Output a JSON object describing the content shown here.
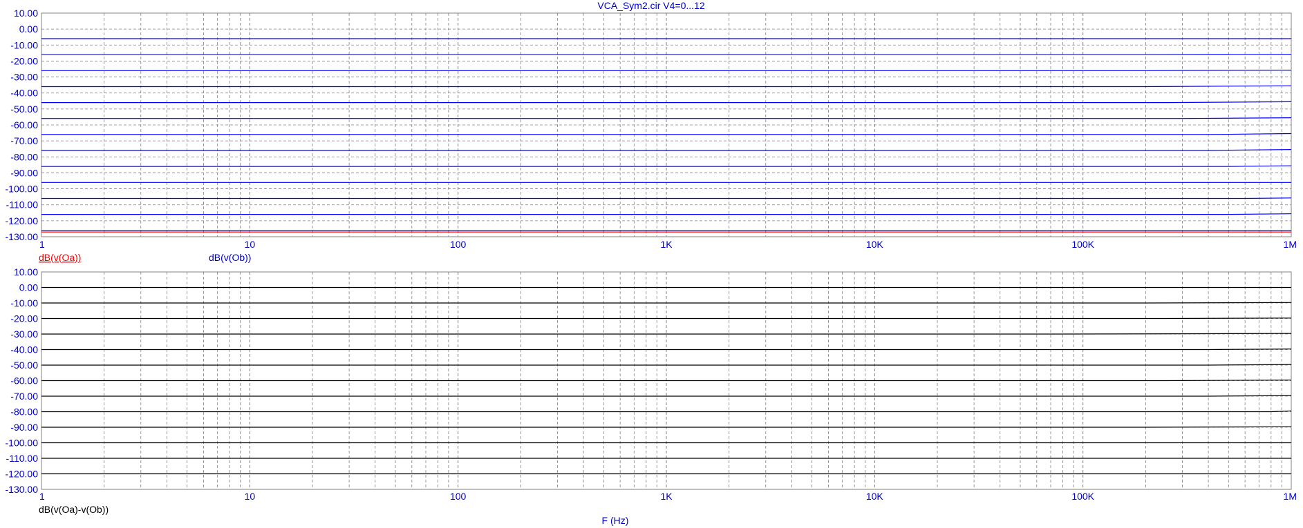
{
  "title": "VCA_Sym2.cir V4=0...12",
  "xlabel": "F (Hz)",
  "colors": {
    "axis_text": "#0000cc",
    "trace_oa": "#ff0000",
    "trace_ob": "#0000ff",
    "trace_diff": "#000000",
    "grid": "#808080"
  },
  "chart_data": [
    {
      "type": "line",
      "x_scale": "log",
      "xlim": [
        1,
        1000000
      ],
      "ylim": [
        -130,
        10
      ],
      "x_ticks": [
        {
          "value": 1,
          "label": "1"
        },
        {
          "value": 10,
          "label": "10"
        },
        {
          "value": 100,
          "label": "100"
        },
        {
          "value": 1000,
          "label": "1K"
        },
        {
          "value": 10000,
          "label": "10K"
        },
        {
          "value": 100000,
          "label": "100K"
        },
        {
          "value": 1000000,
          "label": "1M"
        }
      ],
      "y_ticks": [
        {
          "value": 10,
          "label": "10.00"
        },
        {
          "value": 0,
          "label": "0.00"
        },
        {
          "value": -10,
          "label": "-10.00"
        },
        {
          "value": -20,
          "label": "-20.00"
        },
        {
          "value": -30,
          "label": "-30.00"
        },
        {
          "value": -40,
          "label": "-40.00"
        },
        {
          "value": -50,
          "label": "-50.00"
        },
        {
          "value": -60,
          "label": "-60.00"
        },
        {
          "value": -70,
          "label": "-70.00"
        },
        {
          "value": -80,
          "label": "-80.00"
        },
        {
          "value": -90,
          "label": "-90.00"
        },
        {
          "value": -100,
          "label": "-100.00"
        },
        {
          "value": -110,
          "label": "-110.00"
        },
        {
          "value": -120,
          "label": "-120.00"
        },
        {
          "value": -130,
          "label": "-130.00"
        }
      ],
      "grid": true,
      "legend": [
        {
          "label": "dB(v(Oa))",
          "color": "#ff0000",
          "underline": true
        },
        {
          "label": "dB(v(Ob))",
          "color": "#0000cc",
          "underline": false
        }
      ],
      "series": [
        {
          "color": "#0000ff",
          "x": [
            1,
            1000000
          ],
          "y": [
            -6,
            -6
          ]
        },
        {
          "color": "#0000ff",
          "x": [
            1,
            200000,
            1000000
          ],
          "y": [
            -16,
            -16,
            -15.8
          ]
        },
        {
          "color": "#0000ff",
          "x": [
            1,
            200000,
            1000000
          ],
          "y": [
            -26,
            -26,
            -25.7
          ]
        },
        {
          "color": "#0000ff",
          "x": [
            1,
            200000,
            1000000
          ],
          "y": [
            -36,
            -36,
            -35.5
          ]
        },
        {
          "color": "#0000ff",
          "x": [
            1,
            250000,
            1000000
          ],
          "y": [
            -46,
            -46,
            -45.5
          ]
        },
        {
          "color": "#0000ff",
          "x": [
            1,
            300000,
            1000000
          ],
          "y": [
            -56,
            -56,
            -55.5
          ]
        },
        {
          "color": "#0000ff",
          "x": [
            1,
            400000,
            1000000
          ],
          "y": [
            -66,
            -66,
            -65.4
          ]
        },
        {
          "color": "#0000ff",
          "x": [
            1,
            400000,
            1000000
          ],
          "y": [
            -76,
            -76,
            -75.4
          ]
        },
        {
          "color": "#0000ff",
          "x": [
            1,
            500000,
            1000000
          ],
          "y": [
            -86,
            -86,
            -85.6
          ]
        },
        {
          "color": "#0000ff",
          "x": [
            1,
            1000000
          ],
          "y": [
            -96,
            -96
          ]
        },
        {
          "color": "#0000ff",
          "x": [
            1,
            600000,
            1000000
          ],
          "y": [
            -106,
            -106,
            -105.7
          ]
        },
        {
          "color": "#0000ff",
          "x": [
            1,
            500000,
            1000000
          ],
          "y": [
            -116,
            -116,
            -115.6
          ]
        },
        {
          "color": "#0000ff",
          "x": [
            1,
            1000000
          ],
          "y": [
            -126,
            -126
          ]
        },
        {
          "color": "#ff0000",
          "x": [
            1,
            1000000
          ],
          "y": [
            -127,
            -127
          ]
        }
      ]
    },
    {
      "type": "line",
      "x_scale": "log",
      "xlim": [
        1,
        1000000
      ],
      "ylim": [
        -130,
        10
      ],
      "x_ticks": [
        {
          "value": 1,
          "label": "1"
        },
        {
          "value": 10,
          "label": "10"
        },
        {
          "value": 100,
          "label": "100"
        },
        {
          "value": 1000,
          "label": "1K"
        },
        {
          "value": 10000,
          "label": "10K"
        },
        {
          "value": 100000,
          "label": "100K"
        },
        {
          "value": 1000000,
          "label": "1M"
        }
      ],
      "y_ticks": [
        {
          "value": 10,
          "label": "10.00"
        },
        {
          "value": 0,
          "label": "0.00"
        },
        {
          "value": -10,
          "label": "-10.00"
        },
        {
          "value": -20,
          "label": "-20.00"
        },
        {
          "value": -30,
          "label": "-30.00"
        },
        {
          "value": -40,
          "label": "-40.00"
        },
        {
          "value": -50,
          "label": "-50.00"
        },
        {
          "value": -60,
          "label": "-60.00"
        },
        {
          "value": -70,
          "label": "-70.00"
        },
        {
          "value": -80,
          "label": "-80.00"
        },
        {
          "value": -90,
          "label": "-90.00"
        },
        {
          "value": -100,
          "label": "-100.00"
        },
        {
          "value": -110,
          "label": "-110.00"
        },
        {
          "value": -120,
          "label": "-120.00"
        },
        {
          "value": -130,
          "label": "-130.00"
        }
      ],
      "grid": true,
      "legend": [
        {
          "label": "dB(v(Oa)-v(Ob))",
          "color": "#000000",
          "underline": false
        }
      ],
      "series": [
        {
          "color": "#000000",
          "x": [
            1,
            1000000
          ],
          "y": [
            0,
            0
          ]
        },
        {
          "color": "#000000",
          "x": [
            1,
            200000,
            1000000
          ],
          "y": [
            -10,
            -10,
            -9.7
          ]
        },
        {
          "color": "#000000",
          "x": [
            1,
            250000,
            1000000
          ],
          "y": [
            -20,
            -20,
            -19.7
          ]
        },
        {
          "color": "#000000",
          "x": [
            1,
            80000,
            400000,
            1000000
          ],
          "y": [
            -30,
            -30,
            -29.8,
            -29.6
          ]
        },
        {
          "color": "#000000",
          "x": [
            1,
            400000,
            1000000
          ],
          "y": [
            -40,
            -40,
            -39.6
          ]
        },
        {
          "color": "#000000",
          "x": [
            1,
            400000,
            1000000
          ],
          "y": [
            -50,
            -50,
            -49.6
          ]
        },
        {
          "color": "#000000",
          "x": [
            1,
            250000,
            1000000
          ],
          "y": [
            -60,
            -60,
            -59.6
          ]
        },
        {
          "color": "#000000",
          "x": [
            1,
            400000,
            1000000
          ],
          "y": [
            -70,
            -70,
            -69.6
          ]
        },
        {
          "color": "#000000",
          "x": [
            1,
            800000,
            1000000
          ],
          "y": [
            -80,
            -80,
            -79.5
          ]
        },
        {
          "color": "#000000",
          "x": [
            1,
            200000,
            1000000
          ],
          "y": [
            -90,
            -90,
            -89.7
          ]
        },
        {
          "color": "#000000",
          "x": [
            1,
            1000000
          ],
          "y": [
            -100,
            -100
          ]
        },
        {
          "color": "#000000",
          "x": [
            1,
            1000000
          ],
          "y": [
            -110,
            -110
          ]
        },
        {
          "color": "#000000",
          "x": [
            1,
            1000000
          ],
          "y": [
            -120,
            -120
          ]
        }
      ]
    }
  ]
}
